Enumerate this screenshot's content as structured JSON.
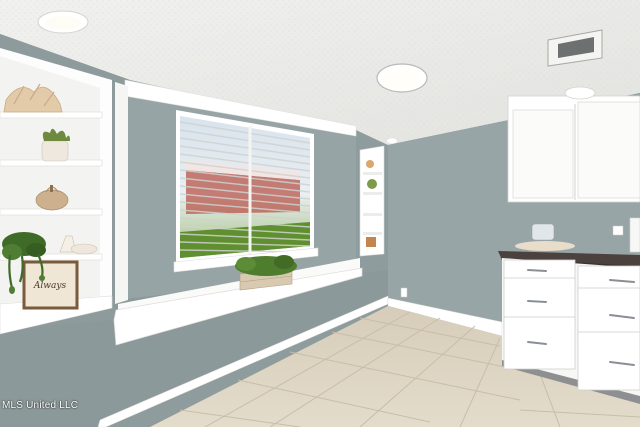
{
  "photo": {
    "watermark": "MLS United LLC",
    "sign_text": "Always"
  },
  "colors": {
    "ceiling": "#ececea",
    "wall": "#97a4a5",
    "wall_dark": "#8b9899",
    "trim": "#ffffff",
    "floor": "#ddd4c2",
    "grout": "#c6bda9",
    "countertop": "#4b4240",
    "hardware": "#8a8f95"
  },
  "icons": [
    "plant-icon",
    "coral-decor-icon",
    "pumpkin-decor-icon",
    "lighthouse-decor-icon"
  ]
}
